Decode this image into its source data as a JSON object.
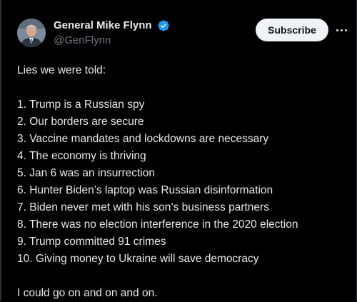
{
  "author": {
    "display_name": "General Mike Flynn",
    "handle": "@GenFlynn",
    "verified_icon": "verified-badge-icon",
    "verified_color": "#1d9bf0"
  },
  "actions": {
    "subscribe_label": "Subscribe",
    "more_icon": "more-options-icon"
  },
  "tweet": {
    "intro": "Lies we were told:",
    "items": [
      "1. Trump is a Russian spy",
      "2. Our borders are secure",
      "3. Vaccine mandates and lockdowns are necessary",
      "4. The economy is thriving",
      "5. Jan 6 was an insurrection",
      "6. Hunter Biden’s laptop was Russian disinformation",
      "7. Biden never met with his son’s business partners",
      "8. There was no election interference in the 2020 election",
      "9. Trump committed 91 crimes",
      "10. Giving money to Ukraine will save democracy"
    ],
    "outro": "I could go on and on and on."
  },
  "colors": {
    "background": "#000000",
    "text": "#e7e9ea",
    "secondary_text": "#71767b",
    "button_bg": "#eff3f4",
    "button_text": "#0f1419"
  }
}
